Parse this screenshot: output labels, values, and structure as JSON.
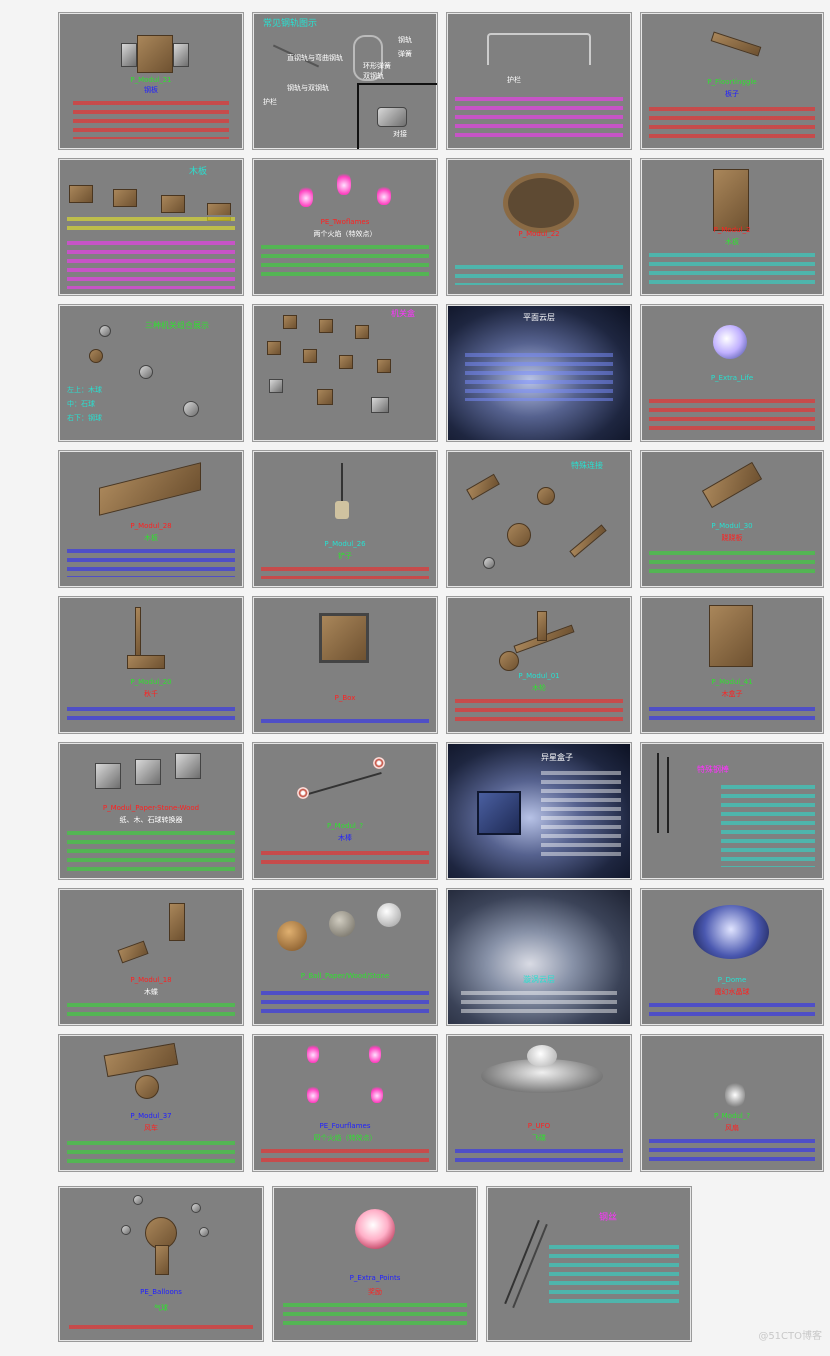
{
  "watermark": "@51CTO博客",
  "tiles": {
    "r1c1": {
      "name": "P_Modul_21",
      "sub": "钢板"
    },
    "r1c2": {
      "title": "常见钢轨图示",
      "l1": "直钢轨与弯曲钢轨",
      "l2": "钢轨",
      "l3": "弹簧",
      "l4": "双钢轨",
      "l5": "环形弹簧",
      "l6": "护栏",
      "l7": "钢轨与双钢轨",
      "l8": "对接"
    },
    "r1c3": {
      "label": "护栏"
    },
    "r1c4": {
      "name": "P_Floortinggle",
      "sub": "板子"
    },
    "r2c1": {
      "title": "木板"
    },
    "r2c2": {
      "name": "PE_Twoflames",
      "sub": "两个火焰（特效点）"
    },
    "r2c3": {
      "name": "P_Modul_22"
    },
    "r2c4": {
      "name": "P_Modul_2",
      "sub": "木板"
    },
    "r3c1": {
      "title": "三种机关组合展示",
      "l1": "左上：木球",
      "l2": "中：石球",
      "l3": "右下：钢球"
    },
    "r3c2": {
      "title": "机关盒"
    },
    "r3c3": {
      "title": "平面云层"
    },
    "r3c4": {
      "name": "P_Extra_Life"
    },
    "r4c1": {
      "name": "P_Modul_28",
      "sub": "木板"
    },
    "r4c2": {
      "name": "P_Modul_26",
      "sub": "铲子"
    },
    "r4c3": {
      "title": "特殊连接"
    },
    "r4c4": {
      "name": "P_Modul_30",
      "sub": "跷跷板"
    },
    "r5c1": {
      "name": "P_Modul_20",
      "sub": "秋千"
    },
    "r5c2": {
      "name": "P_Box"
    },
    "r5c3": {
      "name": "P_Modul_01",
      "sub": "木轮"
    },
    "r5c4": {
      "name": "P_Modul_41",
      "sub": "木盒子"
    },
    "r6c1": {
      "name": "P_Modul_Paper-Stone-Wood",
      "sub": "纸、木、石球转换器"
    },
    "r6c2": {
      "name": "P_Modul_?",
      "sub": "木棒"
    },
    "r6c3": {
      "title": "异星盒子"
    },
    "r6c4": {
      "title": "特殊钢棒"
    },
    "r7c1": {
      "name": "P_Modul_18",
      "sub": "木蝶"
    },
    "r7c2": {
      "name": "P_Ball_Paper/Wood/Stone"
    },
    "r7c3": {
      "title": "漩涡云层"
    },
    "r7c4": {
      "name": "P_Dome",
      "sub": "魔幻水晶球"
    },
    "r8c1": {
      "name": "P_Modul_37",
      "sub": "风车"
    },
    "r8c2": {
      "name": "PE_Fourflames",
      "sub": "四个火焰（特效点）"
    },
    "r8c3": {
      "name": "P_UFO",
      "sub": "飞碟"
    },
    "r8c4": {
      "name": "P_Modul_?",
      "sub": "风扇"
    },
    "r9c1": {
      "name": "PE_Balloons",
      "sub": "气球"
    },
    "r9c2": {
      "name": "P_Extra_Points",
      "sub": "奖励"
    },
    "r9c3": {
      "title": "钢丝"
    }
  }
}
